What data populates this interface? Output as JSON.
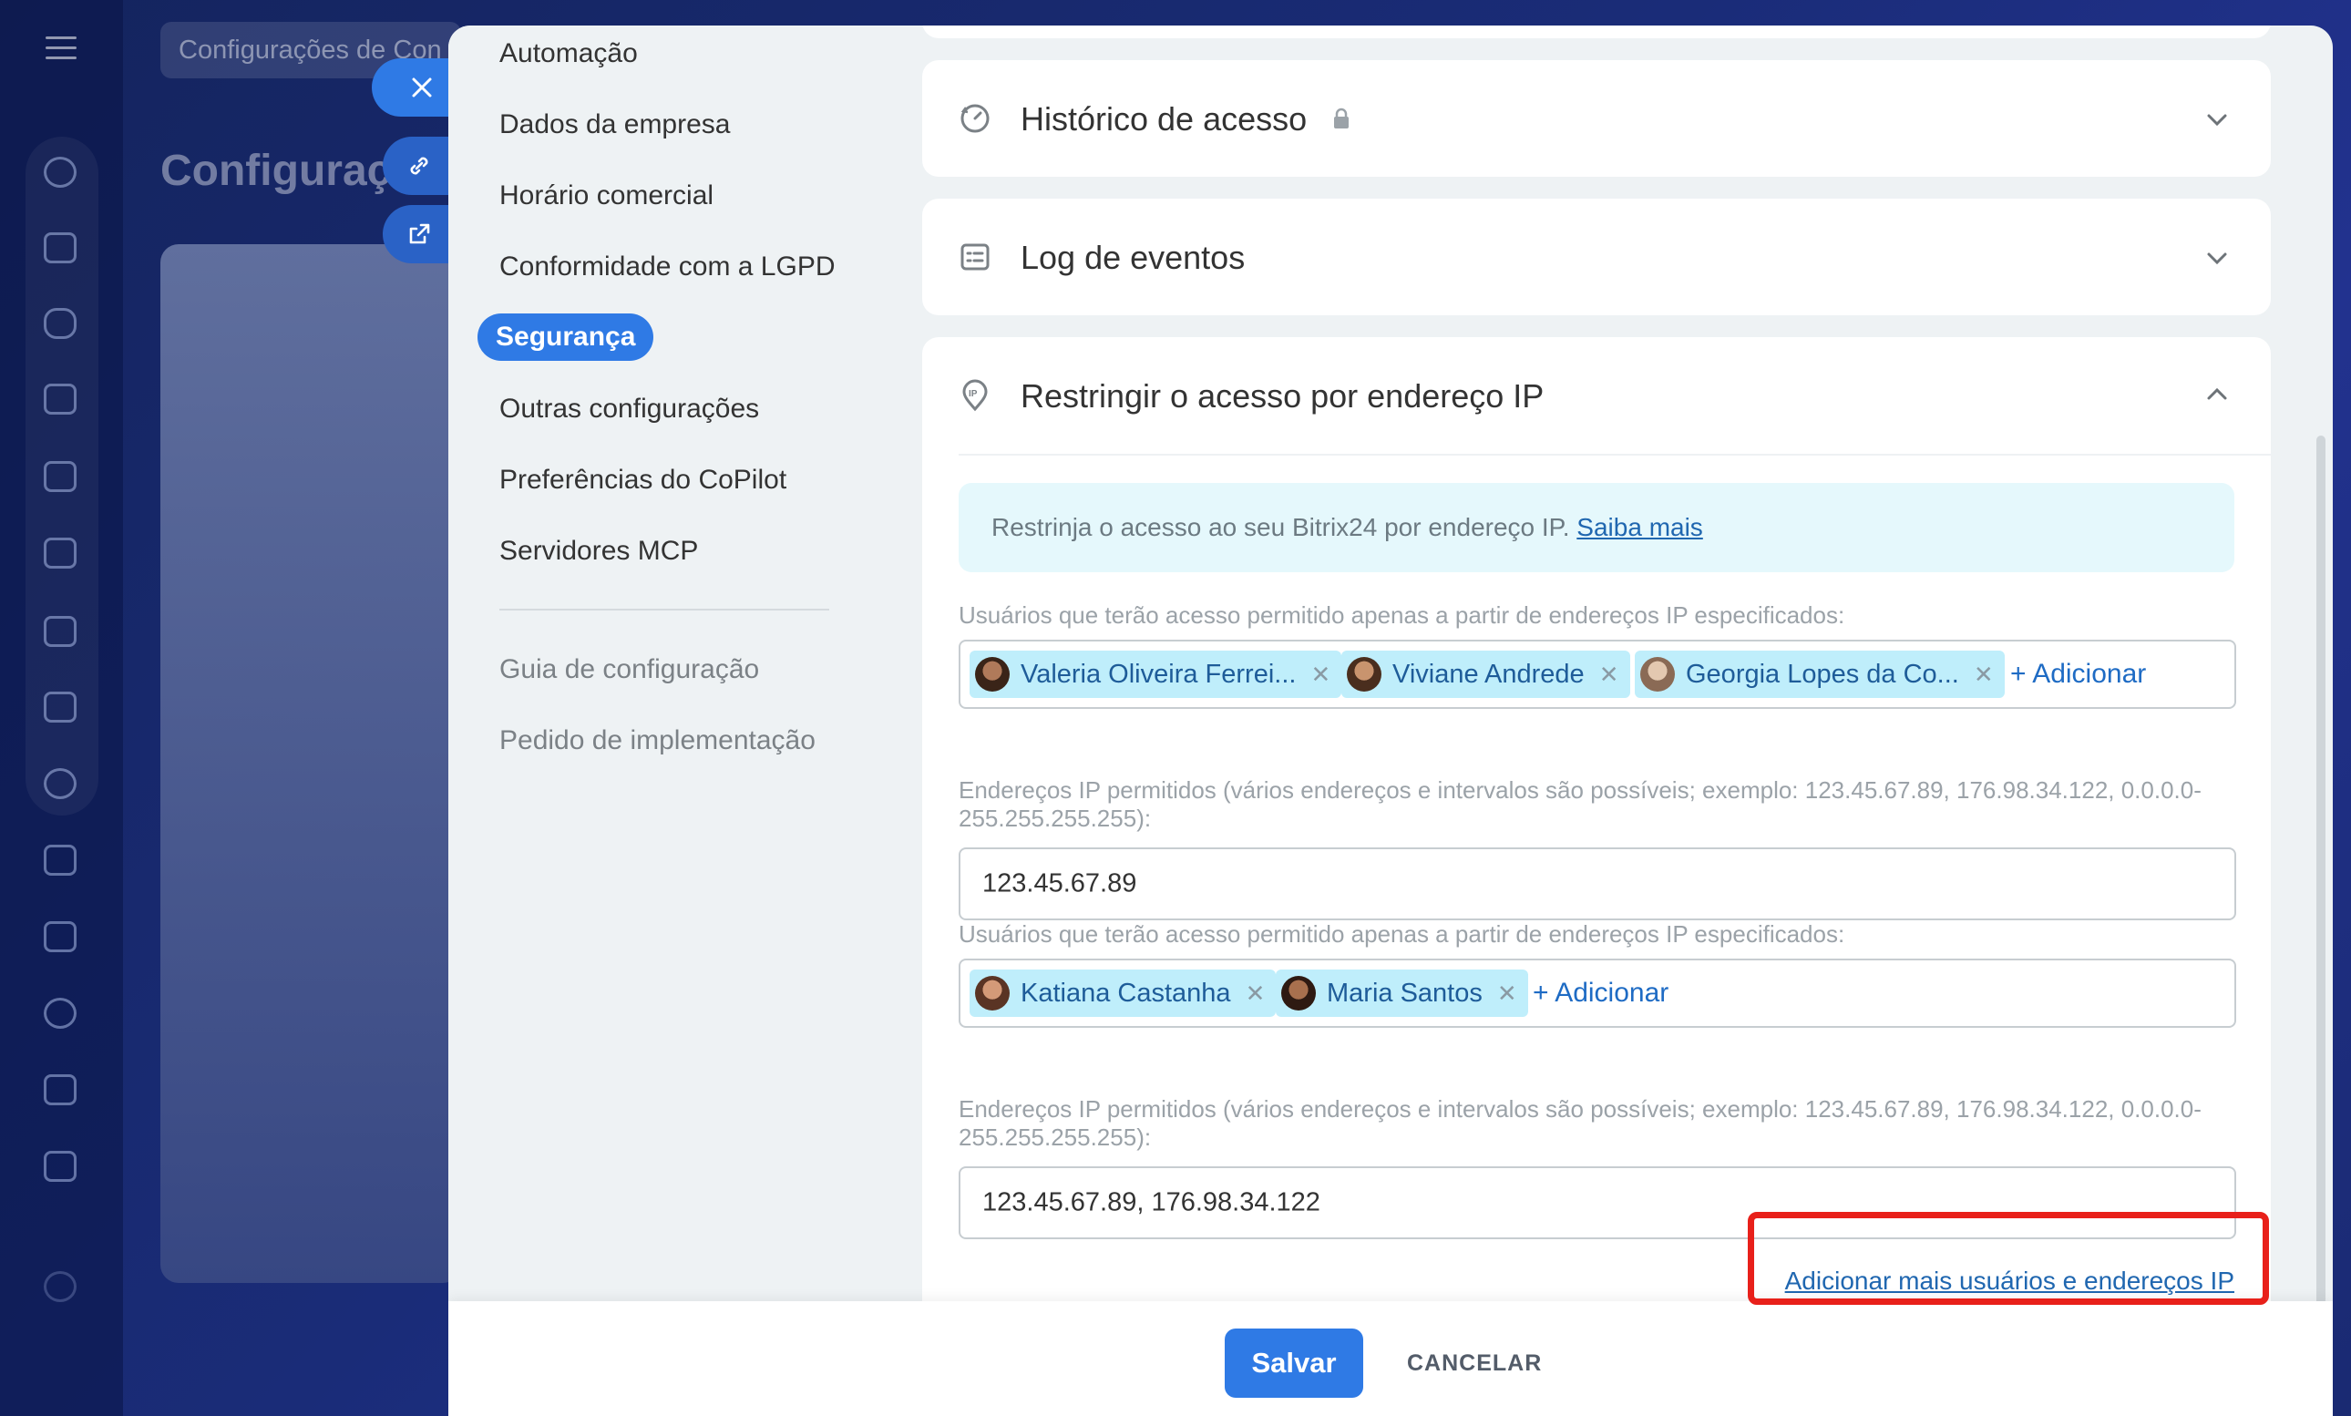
{
  "background": {
    "search_text": "Configurações de Con",
    "title": "Configuraç"
  },
  "nav": {
    "items": [
      {
        "label": "Automação"
      },
      {
        "label": "Dados da empresa"
      },
      {
        "label": "Horário comercial"
      },
      {
        "label": "Conformidade com a LGPD"
      },
      {
        "label": "Segurança",
        "active": true
      },
      {
        "label": "Outras configurações"
      },
      {
        "label": "Preferências do CoPilot"
      },
      {
        "label": "Servidores MCP"
      }
    ],
    "secondary": [
      {
        "label": "Guia de configuração"
      },
      {
        "label": "Pedido de implementação"
      }
    ]
  },
  "sections": {
    "access_history": {
      "title": "Histórico de acesso"
    },
    "event_log": {
      "title": "Log de eventos"
    },
    "ip_restrict": {
      "title": "Restringir o acesso por endereço IP",
      "info_text": "Restrinja o acesso ao seu Bitrix24 por endereço IP.",
      "info_link": "Saiba mais",
      "groups": [
        {
          "users_label": "Usuários que terão acesso permitido apenas a partir de endereços IP especificados:",
          "users": [
            {
              "name": "Valeria Oliveira Ferrei..."
            },
            {
              "name": "Viviane Andrede"
            },
            {
              "name": "Georgia Lopes da Co..."
            }
          ],
          "add_label": "+ Adicionar",
          "ip_label": "Endereços IP permitidos (vários endereços e intervalos são possíveis; exemplo: 123.45.67.89, 176.98.34.122, 0.0.0.0-255.255.255.255):",
          "ip_value": "123.45.67.89"
        },
        {
          "users_label": "Usuários que terão acesso permitido apenas a partir de endereços IP especificados:",
          "users": [
            {
              "name": "Katiana Castanha"
            },
            {
              "name": "Maria Santos"
            }
          ],
          "add_label": "+ Adicionar",
          "ip_label": "Endereços IP permitidos (vários endereços e intervalos são possíveis; exemplo: 123.45.67.89, 176.98.34.122, 0.0.0.0-255.255.255.255):",
          "ip_value": "123.45.67.89, 176.98.34.122"
        }
      ],
      "more_link": "Adicionar mais usuários e endereços IP"
    }
  },
  "footer": {
    "save_label": "Salvar",
    "cancel_label": "CANCELAR"
  },
  "colors": {
    "accent": "#2f7ae5",
    "tag_bg": "#bfeefb",
    "highlight": "#e8201a"
  }
}
